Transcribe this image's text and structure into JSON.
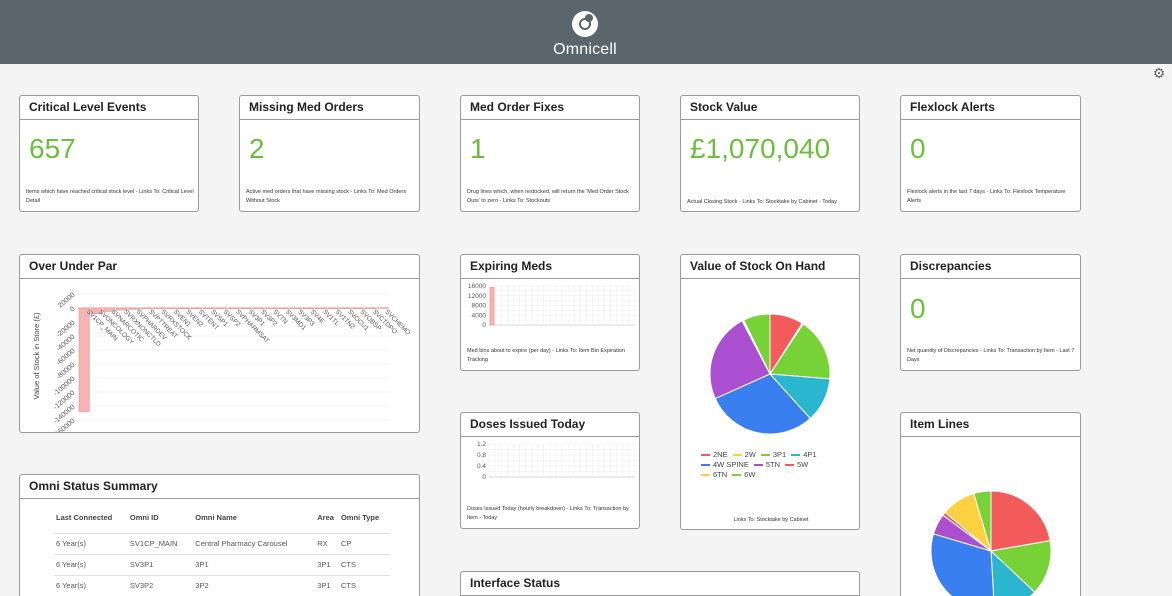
{
  "header": {
    "brand": "Omnicell"
  },
  "cards": {
    "critical": {
      "title": "Critical Level Events",
      "value": "657",
      "desc": "Items which have reached critical stock level - Links To: Critical Level Detail"
    },
    "missing": {
      "title": "Missing Med Orders",
      "value": "2",
      "desc": "Active med orders that have missing stock - Links To: Med Orders Without Stock"
    },
    "fixes": {
      "title": "Med Order Fixes",
      "value": "1",
      "desc": "Drug lines which, when restocked, will return the 'Med Order Stock Outs' to zero - Links To: Stockouts"
    },
    "stockvalue": {
      "title": "Stock Value",
      "value": "£1,070,040",
      "desc": "Actual Closing Stock - Links To: Stocktake by Cabinet - Today"
    },
    "flexlock": {
      "title": "Flexlock Alerts",
      "value": "0",
      "desc": "Flexlock alerts in the last 7 days - Links To: Flexlock Temperature Alerts"
    },
    "discrepancies": {
      "title": "Discrepancies",
      "value": "0",
      "desc": "Net quantity of Discrepancies - Links To: Transaction by Item - Last 7 Days"
    }
  },
  "overunder": {
    "title": "Over Under Par",
    "ylabel": "Value of Stock in Store (£)"
  },
  "expiring": {
    "title": "Expiring Meds",
    "desc": "Med bins about to expire (per day) - Links To: Item Bin Expiration Tracking"
  },
  "doses": {
    "title": "Doses Issued Today",
    "desc": "Doses Issued Today (hourly breakdown) - Links To: Transaction by Item - Today"
  },
  "valueonhand": {
    "title": "Value of Stock On Hand",
    "desc": "Links To: Stocktake by Cabinet"
  },
  "itemlines": {
    "title": "Item Lines"
  },
  "interface": {
    "title": "Interface Status"
  },
  "omni": {
    "title": "Omni Status Summary",
    "columns": [
      "Last Connected",
      "Omni ID",
      "Omni Name",
      "Area",
      "Omni Type"
    ],
    "rows": [
      [
        "6 Year(s)",
        "SV1CP_MAIN",
        "Central Pharmacy Carousel",
        "RX",
        "CP"
      ],
      [
        "6 Year(s)",
        "SV3P1",
        "3P1",
        "3P1",
        "CTS"
      ],
      [
        "6 Year(s)",
        "SV3P2",
        "3P2",
        "3P1",
        "CTS"
      ]
    ]
  },
  "chart_data": [
    {
      "type": "bar",
      "name": "Over Under Par",
      "ylabel": "Value of Stock in Store (£)",
      "ylim": [
        -160000,
        20000
      ],
      "yticks": [
        20000,
        0,
        -20000,
        -40000,
        -60000,
        -80000,
        -100000,
        -120000,
        -140000,
        -160000
      ],
      "categories": [
        "SV1CP_MAIN",
        "SVONCOLOGY",
        "SVNARCOTIC",
        "SVRXNONCTLD",
        "SVPHARDEV",
        "SVPTTREAT",
        "SVRXSTOCK",
        "SVEN1",
        "SVEN2",
        "SVTENT",
        "SVSP1",
        "SVSP2",
        "SVPHARMSAT",
        "SV3P1",
        "SV3P2",
        "SVTN",
        "SV3MD1",
        "SV3P3",
        "SV4E",
        "SV1TL",
        "SV1TN2",
        "SVOCU1",
        "SVOBSP",
        "SVCTDPO",
        "SVCHEMO"
      ],
      "values": [
        -148000,
        -8000,
        -5000,
        -3000,
        -2000,
        -1000,
        -1000,
        -500,
        -500,
        -300,
        -300,
        -200,
        -200,
        -100,
        -100,
        -100,
        0,
        0,
        0,
        0,
        0,
        0,
        0,
        0,
        500
      ],
      "color": "#f7b3b3"
    },
    {
      "type": "bar",
      "name": "Expiring Meds",
      "ylim": [
        0,
        16000
      ],
      "yticks": [
        16000,
        12000,
        8000,
        4000,
        0
      ],
      "values": [
        15500
      ],
      "color": "#f7b3b3"
    },
    {
      "type": "bar",
      "name": "Doses Issued Today",
      "ylim": [
        0,
        1.2
      ],
      "yticks": [
        1.2,
        0.8,
        0.4,
        0
      ],
      "values": []
    },
    {
      "type": "pie",
      "name": "Value of Stock On Hand",
      "legend": "bottom",
      "labels": [
        "2NE",
        "2W",
        "3P1",
        "4P1",
        "4W SPINE",
        "5TN",
        "5W",
        "6TN",
        "6W"
      ],
      "colors": [
        "#f35a5a",
        "#ffd040",
        "#76d237",
        "#2bb6d0",
        "#3a7ff0",
        "#a94fd0",
        "#f35a5a",
        "#ffd040",
        "#76d237"
      ],
      "values": [
        9,
        0.3,
        17,
        12,
        30,
        24,
        0.3,
        0.2,
        7.2
      ]
    },
    {
      "type": "pie",
      "name": "Item Lines",
      "labels": [],
      "colors": [
        "#f35a5a",
        "#76d237",
        "#2bb6d0",
        "#3a7ff0",
        "#a94fd0",
        "#f35a5a",
        "#ffd040",
        "#76d237"
      ],
      "values": [
        24,
        16,
        13,
        33,
        6,
        1,
        10,
        5
      ]
    }
  ]
}
